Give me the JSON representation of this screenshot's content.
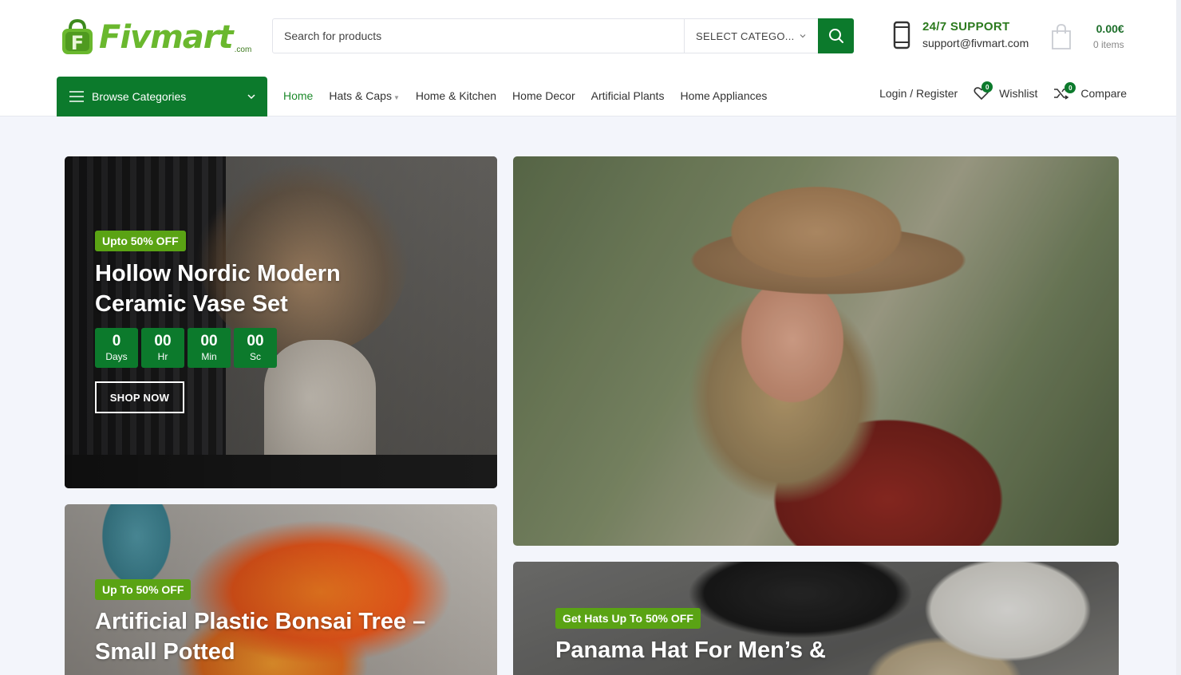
{
  "brand": {
    "name": "Fivmart",
    "tld": ".com"
  },
  "search": {
    "placeholder": "Search for products",
    "category": "SELECT CATEGO..."
  },
  "support": {
    "title": "24/7 SUPPORT",
    "email": "support@fivmart.com"
  },
  "cart": {
    "total": "0.00€",
    "items": "0 items"
  },
  "nav": {
    "browse_label": "Browse Categories",
    "items": [
      {
        "label": "Home",
        "active": true
      },
      {
        "label": "Hats & Caps",
        "has_dropdown": true
      },
      {
        "label": "Home & Kitchen"
      },
      {
        "label": "Home Decor"
      },
      {
        "label": "Artificial Plants"
      },
      {
        "label": "Home Appliances"
      }
    ],
    "login": "Login / Register",
    "wishlist": {
      "label": "Wishlist",
      "count": "0"
    },
    "compare": {
      "label": "Compare",
      "count": "0"
    }
  },
  "banners": {
    "vase": {
      "tag": "Upto 50% OFF",
      "title_line1": "Hollow Nordic Modern",
      "title_line2": "Ceramic Vase Set",
      "countdown": [
        {
          "value": "0",
          "unit": "Days"
        },
        {
          "value": "00",
          "unit": "Hr"
        },
        {
          "value": "00",
          "unit": "Min"
        },
        {
          "value": "00",
          "unit": "Sc"
        }
      ],
      "button": "SHOP NOW"
    },
    "bonsai": {
      "tag": "Up To 50% OFF",
      "title_line1": "Artificial Plastic Bonsai Tree –",
      "title_line2": "Small Potted"
    },
    "panama": {
      "tag": "Get Hats Up To 50% OFF",
      "title_line1": "Panama Hat For Men’s &"
    }
  },
  "colors": {
    "primary_green": "#0c7a2c",
    "tag_green": "#5aa314",
    "logo_green": "#6ab82e"
  }
}
